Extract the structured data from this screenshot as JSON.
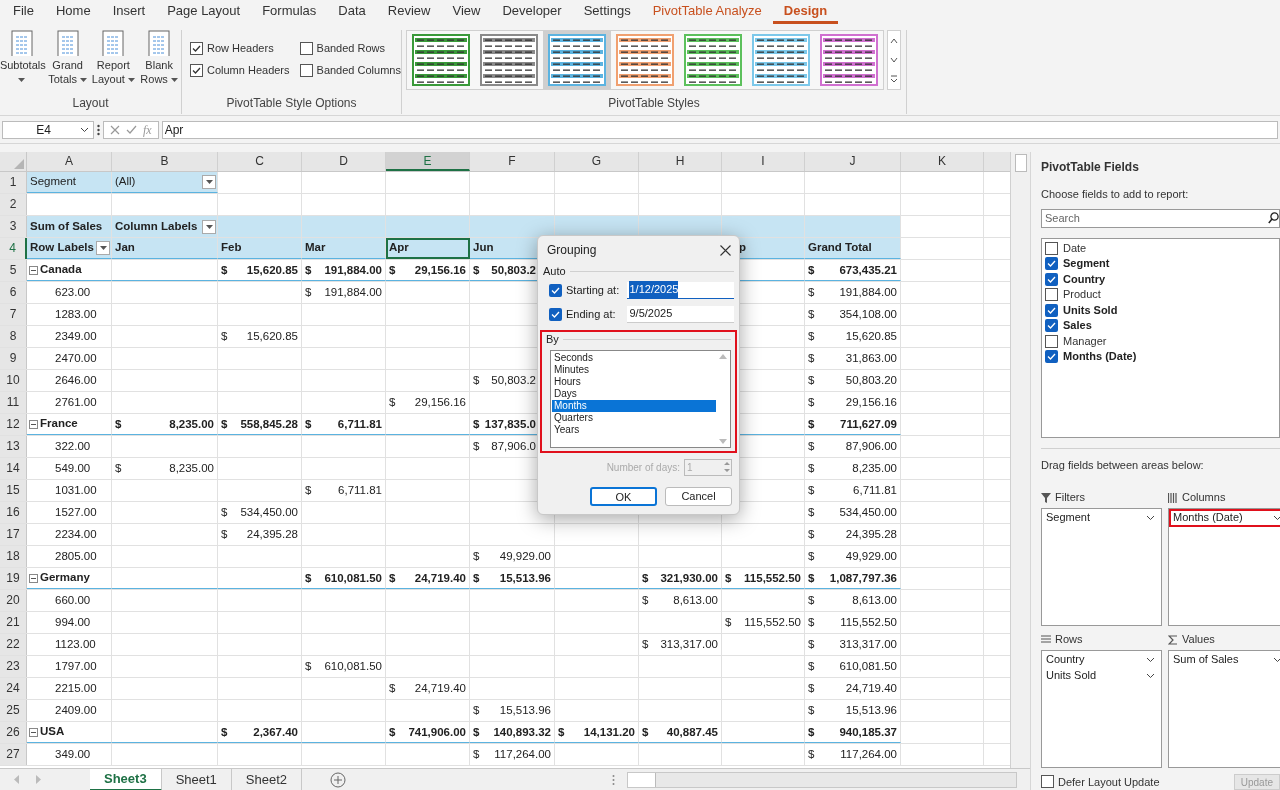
{
  "menu_tabs": [
    {
      "label": "File",
      "kind": "normal",
      "selected": false
    },
    {
      "label": "Home",
      "kind": "normal",
      "selected": false
    },
    {
      "label": "Insert",
      "kind": "normal",
      "selected": false
    },
    {
      "label": "Page Layout",
      "kind": "normal",
      "selected": false
    },
    {
      "label": "Formulas",
      "kind": "normal",
      "selected": false
    },
    {
      "label": "Data",
      "kind": "normal",
      "selected": false
    },
    {
      "label": "Review",
      "kind": "normal",
      "selected": false
    },
    {
      "label": "View",
      "kind": "normal",
      "selected": false
    },
    {
      "label": "Developer",
      "kind": "normal",
      "selected": false
    },
    {
      "label": "Settings",
      "kind": "normal",
      "selected": false
    },
    {
      "label": "PivotTable Analyze",
      "kind": "contextual",
      "selected": false
    },
    {
      "label": "Design",
      "kind": "contextual",
      "selected": true
    }
  ],
  "ribbon": {
    "layout_group": {
      "label": "Layout",
      "buttons": [
        {
          "label": "Subtotals"
        },
        {
          "label": "Grand Totals"
        },
        {
          "label": "Report Layout"
        },
        {
          "label": "Blank Rows"
        }
      ]
    },
    "style_options_group": {
      "label": "PivotTable Style Options",
      "options": [
        {
          "label": "Row Headers",
          "checked": true
        },
        {
          "label": "Banded Rows",
          "checked": false
        },
        {
          "label": "Column Headers",
          "checked": true
        },
        {
          "label": "Banded Columns",
          "checked": false
        }
      ]
    },
    "styles_group": {
      "label": "PivotTable Styles",
      "styles": [
        {
          "color": "#3a9a3a",
          "selected": false
        },
        {
          "color": "#8a8a8a",
          "selected": false
        },
        {
          "color": "#5bb3e0",
          "selected": true
        },
        {
          "color": "#f0a070",
          "selected": false
        },
        {
          "color": "#5cc05c",
          "selected": false
        },
        {
          "color": "#7cc8ea",
          "selected": false
        },
        {
          "color": "#d070d0",
          "selected": false
        }
      ]
    }
  },
  "formula_bar": {
    "name_box": "E4",
    "function_label": "fx",
    "value": "Apr"
  },
  "sheet": {
    "columns": [
      {
        "label": "A",
        "selected": false
      },
      {
        "label": "B",
        "selected": false
      },
      {
        "label": "C",
        "selected": false
      },
      {
        "label": "D",
        "selected": false
      },
      {
        "label": "E",
        "selected": true
      },
      {
        "label": "F",
        "selected": false
      },
      {
        "label": "G",
        "selected": false
      },
      {
        "label": "H",
        "selected": false
      },
      {
        "label": "I",
        "selected": false
      },
      {
        "label": "J",
        "selected": false
      },
      {
        "label": "K",
        "selected": false
      }
    ],
    "rows": [
      {
        "number": "1",
        "kind": "filter",
        "selected": false,
        "cells": [
          "Segment",
          "(All)",
          "",
          "",
          "",
          "",
          "",
          "",
          "",
          ""
        ]
      },
      {
        "number": "2",
        "kind": "blank",
        "selected": false,
        "cells": [
          "",
          "",
          "",
          "",
          "",
          "",
          "",
          "",
          "",
          ""
        ]
      },
      {
        "number": "3",
        "kind": "values-header",
        "selected": false,
        "cells": [
          "Sum of Sales",
          "Column Labels",
          "",
          "",
          "",
          "",
          "",
          "",
          "",
          ""
        ]
      },
      {
        "number": "4",
        "kind": "labels-header",
        "selected": true,
        "cells": [
          "Row Labels",
          "Jan",
          "Feb",
          "Mar",
          "Apr",
          "Jun",
          "",
          "",
          "p",
          "Grand Total"
        ]
      },
      {
        "number": "5",
        "kind": "group",
        "selected": false,
        "cells": [
          "Canada",
          "",
          "$ 15,620.85",
          "$ 191,884.00",
          "$ 29,156.16",
          "$ 50,803.2",
          "",
          "",
          "",
          "$ 673,435.21"
        ]
      },
      {
        "number": "6",
        "kind": "item",
        "selected": false,
        "cells": [
          "623.00",
          "",
          "",
          "$ 191,884.00",
          "",
          "",
          "",
          "",
          "",
          "$ 191,884.00"
        ]
      },
      {
        "number": "7",
        "kind": "item",
        "selected": false,
        "cells": [
          "1283.00",
          "",
          "",
          "",
          "",
          "",
          "",
          "",
          "",
          "$ 354,108.00"
        ]
      },
      {
        "number": "8",
        "kind": "item",
        "selected": false,
        "cells": [
          "2349.00",
          "",
          "$ 15,620.85",
          "",
          "",
          "",
          "",
          "",
          "",
          "$ 15,620.85"
        ]
      },
      {
        "number": "9",
        "kind": "item",
        "selected": false,
        "cells": [
          "2470.00",
          "",
          "",
          "",
          "",
          "",
          "",
          "",
          "",
          "$ 31,863.00"
        ]
      },
      {
        "number": "10",
        "kind": "item",
        "selected": false,
        "cells": [
          "2646.00",
          "",
          "",
          "",
          "",
          "$ 50,803.2",
          "",
          "",
          "",
          "$ 50,803.20"
        ]
      },
      {
        "number": "11",
        "kind": "item",
        "selected": false,
        "cells": [
          "2761.00",
          "",
          "",
          "",
          "$ 29,156.16",
          "",
          "",
          "",
          "",
          "$ 29,156.16"
        ]
      },
      {
        "number": "12",
        "kind": "group",
        "selected": false,
        "cells": [
          "France",
          "$ 8,235.00",
          "$ 558,845.28",
          "$ 6,711.81",
          "",
          "$ 137,835.0",
          "",
          "",
          "",
          "$ 711,627.09"
        ]
      },
      {
        "number": "13",
        "kind": "item",
        "selected": false,
        "cells": [
          "322.00",
          "",
          "",
          "",
          "",
          "$ 87,906.0",
          "",
          "",
          "",
          "$ 87,906.00"
        ]
      },
      {
        "number": "14",
        "kind": "item",
        "selected": false,
        "cells": [
          "549.00",
          "$ 8,235.00",
          "",
          "",
          "",
          "",
          "",
          "",
          "",
          "$ 8,235.00"
        ]
      },
      {
        "number": "15",
        "kind": "item",
        "selected": false,
        "cells": [
          "1031.00",
          "",
          "",
          "$ 6,711.81",
          "",
          "",
          "",
          "",
          "",
          "$ 6,711.81"
        ]
      },
      {
        "number": "16",
        "kind": "item",
        "selected": false,
        "cells": [
          "1527.00",
          "",
          "$ 534,450.00",
          "",
          "",
          "",
          "",
          "",
          "",
          "$ 534,450.00"
        ]
      },
      {
        "number": "17",
        "kind": "item",
        "selected": false,
        "cells": [
          "2234.00",
          "",
          "$ 24,395.28",
          "",
          "",
          "",
          "",
          "",
          "",
          "$ 24,395.28"
        ]
      },
      {
        "number": "18",
        "kind": "item",
        "selected": false,
        "cells": [
          "2805.00",
          "",
          "",
          "",
          "",
          "$ 49,929.00",
          "",
          "",
          "",
          "$ 49,929.00"
        ]
      },
      {
        "number": "19",
        "kind": "group",
        "selected": false,
        "cells": [
          "Germany",
          "",
          "",
          "$ 610,081.50",
          "$ 24,719.40",
          "$ 15,513.96",
          "",
          "$ 321,930.00",
          "$ 115,552.50",
          "$ 1,087,797.36"
        ]
      },
      {
        "number": "20",
        "kind": "item",
        "selected": false,
        "cells": [
          "660.00",
          "",
          "",
          "",
          "",
          "",
          "",
          "$ 8,613.00",
          "",
          "$ 8,613.00"
        ]
      },
      {
        "number": "21",
        "kind": "item",
        "selected": false,
        "cells": [
          "994.00",
          "",
          "",
          "",
          "",
          "",
          "",
          "",
          "$ 115,552.50",
          "$ 115,552.50"
        ]
      },
      {
        "number": "22",
        "kind": "item",
        "selected": false,
        "cells": [
          "1123.00",
          "",
          "",
          "",
          "",
          "",
          "",
          "$ 313,317.00",
          "",
          "$ 313,317.00"
        ]
      },
      {
        "number": "23",
        "kind": "item",
        "selected": false,
        "cells": [
          "1797.00",
          "",
          "",
          "$ 610,081.50",
          "",
          "",
          "",
          "",
          "",
          "$ 610,081.50"
        ]
      },
      {
        "number": "24",
        "kind": "item",
        "selected": false,
        "cells": [
          "2215.00",
          "",
          "",
          "",
          "$ 24,719.40",
          "",
          "",
          "",
          "",
          "$ 24,719.40"
        ]
      },
      {
        "number": "25",
        "kind": "item",
        "selected": false,
        "cells": [
          "2409.00",
          "",
          "",
          "",
          "",
          "$ 15,513.96",
          "",
          "",
          "",
          "$ 15,513.96"
        ]
      },
      {
        "number": "26",
        "kind": "group",
        "selected": false,
        "cells": [
          "USA",
          "",
          "$ 2,367.40",
          "",
          "$ 741,906.00",
          "$ 140,893.32",
          "$ 14,131.20",
          "$ 40,887.45",
          "",
          "$ 940,185.37"
        ]
      },
      {
        "number": "27",
        "kind": "item",
        "selected": false,
        "cells": [
          "349.00",
          "",
          "",
          "",
          "",
          "$ 117,264.00",
          "",
          "",
          "",
          "$ 117,264.00"
        ]
      }
    ]
  },
  "sheet_tabs": [
    {
      "label": "Sheet3",
      "selected": true
    },
    {
      "label": "Sheet1",
      "selected": false
    },
    {
      "label": "Sheet2",
      "selected": false
    }
  ],
  "grouping_dialog": {
    "title": "Grouping",
    "auto_label": "Auto",
    "starting": {
      "label": "Starting at:",
      "checked": true,
      "value": "1/12/2025"
    },
    "ending": {
      "label": "Ending at:",
      "checked": true,
      "value": "9/5/2025"
    },
    "by_group": {
      "label": "By",
      "highlighted": true,
      "options": [
        {
          "label": "Seconds",
          "selected": false
        },
        {
          "label": "Minutes",
          "selected": false
        },
        {
          "label": "Hours",
          "selected": false
        },
        {
          "label": "Days",
          "selected": false
        },
        {
          "label": "Months",
          "selected": true
        },
        {
          "label": "Quarters",
          "selected": false
        },
        {
          "label": "Years",
          "selected": false
        }
      ]
    },
    "days": {
      "label": "Number of days:",
      "value": "1",
      "disabled": true
    },
    "buttons": [
      {
        "label": "OK",
        "kind": "default"
      },
      {
        "label": "Cancel",
        "kind": "normal"
      }
    ]
  },
  "field_pane": {
    "title": "PivotTable Fields",
    "subtitle": "Choose fields to add to report:",
    "search": {
      "placeholder": "Search"
    },
    "fields": [
      {
        "label": "Date",
        "checked": false
      },
      {
        "label": "Segment",
        "checked": true
      },
      {
        "label": "Country",
        "checked": true
      },
      {
        "label": "Product",
        "checked": false
      },
      {
        "label": "Units Sold",
        "checked": true
      },
      {
        "label": "Sales",
        "checked": true
      },
      {
        "label": "Manager",
        "checked": false
      },
      {
        "label": "Months (Date)",
        "checked": true
      }
    ],
    "areas_hint": "Drag fields between areas below:",
    "areas": [
      {
        "kind": "filters",
        "label": "Filters",
        "items": [
          {
            "label": "Segment",
            "highlighted": false
          }
        ]
      },
      {
        "kind": "columns",
        "label": "Columns",
        "items": [
          {
            "label": "Months (Date)",
            "highlighted": true
          }
        ]
      },
      {
        "kind": "rows",
        "label": "Rows",
        "items": [
          {
            "label": "Country",
            "highlighted": false
          },
          {
            "label": "Units Sold",
            "highlighted": false
          }
        ]
      },
      {
        "kind": "values",
        "label": "Values",
        "items": [
          {
            "label": "Sum of Sales",
            "highlighted": false
          }
        ]
      }
    ],
    "defer": {
      "label": "Defer Layout Update",
      "checked": false
    },
    "update_button": "Update"
  }
}
